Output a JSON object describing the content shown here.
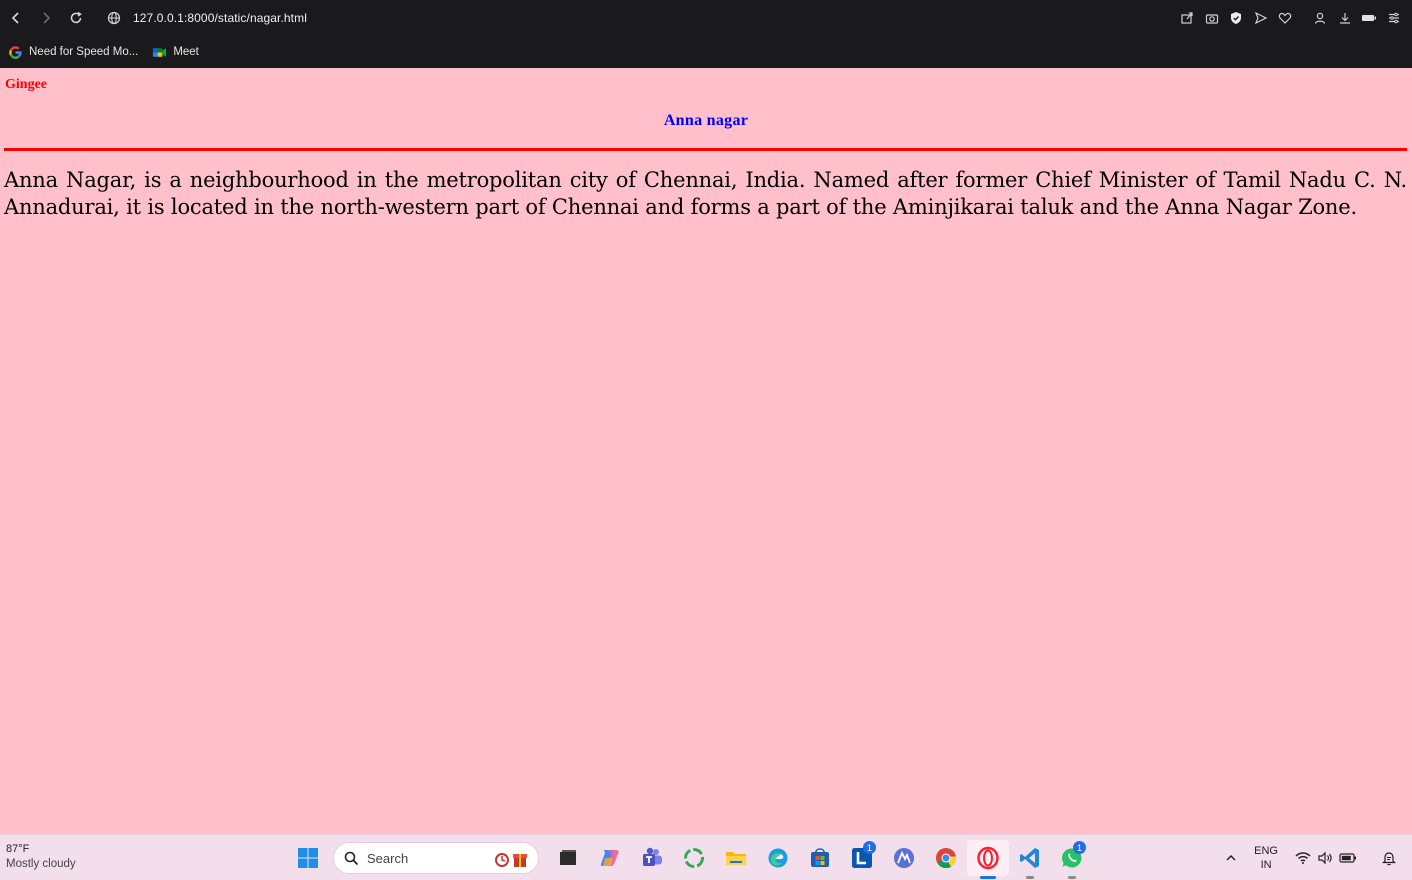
{
  "browser": {
    "url": "127.0.0.1:8000/static/nagar.html",
    "bookmarks": [
      {
        "label": "Need for Speed Mo...",
        "icon": "google-g-icon"
      },
      {
        "label": "Meet",
        "icon": "google-meet-icon"
      }
    ]
  },
  "page": {
    "site_name": "Gingee",
    "title": "Anna nagar",
    "body": "Anna Nagar, is a neighbourhood in the metropolitan city of Chennai, India. Named after former Chief Minister of Tamil Nadu C. N. Annadurai, it is located in the north-western part of Chennai and forms a part of the Aminjikarai taluk and the Anna Nagar Zone.",
    "colors": {
      "background": "#ffc0cb",
      "site_name": "#ff0000",
      "title": "#0000ff",
      "divider": "#ff0000"
    }
  },
  "taskbar": {
    "weather_temp": "87°F",
    "weather_desc": "Mostly cloudy",
    "search_placeholder": "Search",
    "apps": [
      {
        "name": "file-explorer-dark"
      },
      {
        "name": "copilot"
      },
      {
        "name": "teams"
      },
      {
        "name": "green-ring-app"
      },
      {
        "name": "file-explorer"
      },
      {
        "name": "edge"
      },
      {
        "name": "microsoft-store"
      },
      {
        "name": "linkedin",
        "badge": "1"
      },
      {
        "name": "vector-app"
      },
      {
        "name": "chrome"
      },
      {
        "name": "opera",
        "active": true
      },
      {
        "name": "vscode"
      },
      {
        "name": "whatsapp",
        "badge": "1"
      }
    ],
    "lang_top": "ENG",
    "lang_bottom": "IN"
  }
}
